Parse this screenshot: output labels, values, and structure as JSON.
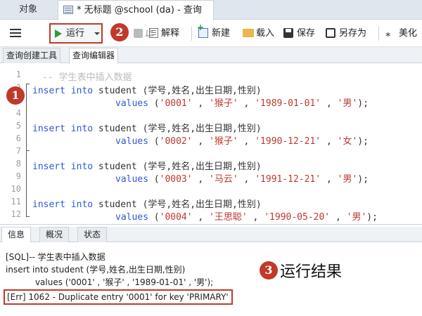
{
  "window": {
    "objects_tab": "对象",
    "query_tab_title": "* 无标题 @school (da) - 查询"
  },
  "toolbar": {
    "run_label": "运行",
    "stop_label": "止",
    "explain_label": "解释",
    "new_label": "新建",
    "load_label": "载入",
    "save_label": "保存",
    "saveas_label": "另存为",
    "beautify_label": "美化"
  },
  "subtabs": [
    "查询创建工具",
    "查询编辑器"
  ],
  "editor": {
    "line_numbers": [
      "1",
      "2",
      "3",
      "4",
      "5",
      "6",
      "7",
      "8",
      "9",
      "10",
      "11",
      "12"
    ],
    "comment": "-- 学生表中插入数据",
    "kw_insert": "insert",
    "kw_into": "into",
    "table": " student ",
    "columns": "(学号,姓名,出生日期,性别)",
    "kw_values": "values",
    "rows": [
      {
        "id": "'0001'",
        "name": "'猴子'",
        "birth": "'1989-01-01'",
        "gender": "'男'"
      },
      {
        "id": "'0002'",
        "name": "'猴子'",
        "birth": "'1990-12-21'",
        "gender": "'女'"
      },
      {
        "id": "'0003'",
        "name": "'马云'",
        "birth": "'1991-12-21'",
        "gender": "'男'"
      },
      {
        "id": "'0004'",
        "name": "'王思聪'",
        "birth": "'1990-05-20'",
        "gender": "'男'"
      }
    ]
  },
  "bottom_tabs": [
    "信息",
    "概况",
    "状态"
  ],
  "output": {
    "line1": "[SQL]-- 学生表中插入数据",
    "line2": "insert into student (学号,姓名,出生日期,性别)",
    "line3": "           values ('0001' , '猴子' , '1989-01-01' , '男');",
    "error": "[Err] 1062 - Duplicate entry '0001' for key 'PRIMARY'"
  },
  "annotations": {
    "badge1": "1",
    "badge2": "2",
    "badge3": "3",
    "result_label": "运行结果"
  },
  "colors": {
    "keyword": "#2f57d6",
    "string": "#c0392b",
    "comment": "#b8bcc2",
    "annotation_red": "#c0392b",
    "run_green": "#2e9a3a"
  }
}
